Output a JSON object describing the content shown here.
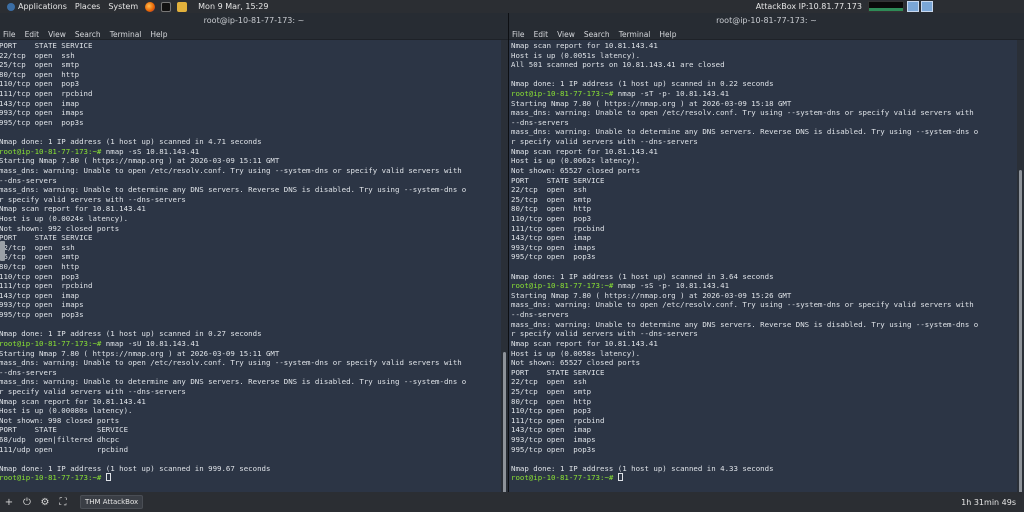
{
  "topbar": {
    "applications": "Applications",
    "places": "Places",
    "system": "System",
    "datetime": "Mon 9 Mar, 15:29",
    "attackbox_ip": "AttackBox IP:10.81.77.173"
  },
  "left_window": {
    "title": "root@ip-10-81-77-173: ~",
    "menu": [
      "File",
      "Edit",
      "View",
      "Search",
      "Terminal",
      "Help"
    ],
    "prompt": "root@ip-10-81-77-173:~#",
    "lines": [
      {
        "t": "PORT    STATE SERVICE"
      },
      {
        "t": "22/tcp  open  ssh"
      },
      {
        "t": "25/tcp  open  smtp"
      },
      {
        "t": "80/tcp  open  http"
      },
      {
        "t": "110/tcp open  pop3"
      },
      {
        "t": "111/tcp open  rpcbind"
      },
      {
        "t": "143/tcp open  imap"
      },
      {
        "t": "993/tcp open  imaps"
      },
      {
        "t": "995/tcp open  pop3s"
      },
      {
        "t": ""
      },
      {
        "t": "Nmap done: 1 IP address (1 host up) scanned in 4.71 seconds"
      },
      {
        "p": true,
        "t": " nmap -sS 10.81.143.41"
      },
      {
        "t": "Starting Nmap 7.80 ( https://nmap.org ) at 2026-03-09 15:11 GMT"
      },
      {
        "t": "mass_dns: warning: Unable to open /etc/resolv.conf. Try using --system-dns or specify valid servers with"
      },
      {
        "t": "--dns-servers"
      },
      {
        "t": "mass_dns: warning: Unable to determine any DNS servers. Reverse DNS is disabled. Try using --system-dns o"
      },
      {
        "t": "r specify valid servers with --dns-servers"
      },
      {
        "t": "Nmap scan report for 10.81.143.41"
      },
      {
        "t": "Host is up (0.0024s latency)."
      },
      {
        "t": "Not shown: 992 closed ports"
      },
      {
        "t": "PORT    STATE SERVICE"
      },
      {
        "t": "22/tcp  open  ssh"
      },
      {
        "t": "25/tcp  open  smtp"
      },
      {
        "t": "80/tcp  open  http"
      },
      {
        "t": "110/tcp open  pop3"
      },
      {
        "t": "111/tcp open  rpcbind"
      },
      {
        "t": "143/tcp open  imap"
      },
      {
        "t": "993/tcp open  imaps"
      },
      {
        "t": "995/tcp open  pop3s"
      },
      {
        "t": ""
      },
      {
        "t": "Nmap done: 1 IP address (1 host up) scanned in 0.27 seconds"
      },
      {
        "p": true,
        "t": " nmap -sU 10.81.143.41"
      },
      {
        "t": "Starting Nmap 7.80 ( https://nmap.org ) at 2026-03-09 15:11 GMT"
      },
      {
        "t": "mass_dns: warning: Unable to open /etc/resolv.conf. Try using --system-dns or specify valid servers with"
      },
      {
        "t": "--dns-servers"
      },
      {
        "t": "mass_dns: warning: Unable to determine any DNS servers. Reverse DNS is disabled. Try using --system-dns o"
      },
      {
        "t": "r specify valid servers with --dns-servers"
      },
      {
        "t": "Nmap scan report for 10.81.143.41"
      },
      {
        "t": "Host is up (0.00080s latency)."
      },
      {
        "t": "Not shown: 998 closed ports"
      },
      {
        "t": "PORT    STATE         SERVICE"
      },
      {
        "t": "68/udp  open|filtered dhcpc"
      },
      {
        "t": "111/udp open          rpcbind"
      },
      {
        "t": ""
      },
      {
        "t": "Nmap done: 1 IP address (1 host up) scanned in 999.67 seconds"
      },
      {
        "p": true,
        "t": " ",
        "cursor": true
      }
    ]
  },
  "right_window": {
    "title": "root@ip-10-81-77-173: ~",
    "menu": [
      "File",
      "Edit",
      "View",
      "Search",
      "Terminal",
      "Help"
    ],
    "prompt": "root@ip-10-81-77-173:~#",
    "lines": [
      {
        "t": "Nmap scan report for 10.81.143.41"
      },
      {
        "t": "Host is up (0.0051s latency)."
      },
      {
        "t": "All 501 scanned ports on 10.81.143.41 are closed"
      },
      {
        "t": ""
      },
      {
        "t": "Nmap done: 1 IP address (1 host up) scanned in 0.22 seconds"
      },
      {
        "p": true,
        "t": " nmap -sT -p- 10.81.143.41"
      },
      {
        "t": "Starting Nmap 7.80 ( https://nmap.org ) at 2026-03-09 15:18 GMT"
      },
      {
        "t": "mass_dns: warning: Unable to open /etc/resolv.conf. Try using --system-dns or specify valid servers with"
      },
      {
        "t": "--dns-servers"
      },
      {
        "t": "mass_dns: warning: Unable to determine any DNS servers. Reverse DNS is disabled. Try using --system-dns o"
      },
      {
        "t": "r specify valid servers with --dns-servers"
      },
      {
        "t": "Nmap scan report for 10.81.143.41"
      },
      {
        "t": "Host is up (0.0062s latency)."
      },
      {
        "t": "Not shown: 65527 closed ports"
      },
      {
        "t": "PORT    STATE SERVICE"
      },
      {
        "t": "22/tcp  open  ssh"
      },
      {
        "t": "25/tcp  open  smtp"
      },
      {
        "t": "80/tcp  open  http"
      },
      {
        "t": "110/tcp open  pop3"
      },
      {
        "t": "111/tcp open  rpcbind"
      },
      {
        "t": "143/tcp open  imap"
      },
      {
        "t": "993/tcp open  imaps"
      },
      {
        "t": "995/tcp open  pop3s"
      },
      {
        "t": ""
      },
      {
        "t": "Nmap done: 1 IP address (1 host up) scanned in 3.64 seconds"
      },
      {
        "p": true,
        "t": " nmap -sS -p- 10.81.143.41"
      },
      {
        "t": "Starting Nmap 7.80 ( https://nmap.org ) at 2026-03-09 15:26 GMT"
      },
      {
        "t": "mass_dns: warning: Unable to open /etc/resolv.conf. Try using --system-dns or specify valid servers with"
      },
      {
        "t": "--dns-servers"
      },
      {
        "t": "mass_dns: warning: Unable to determine any DNS servers. Reverse DNS is disabled. Try using --system-dns o"
      },
      {
        "t": "r specify valid servers with --dns-servers"
      },
      {
        "t": "Nmap scan report for 10.81.143.41"
      },
      {
        "t": "Host is up (0.0058s latency)."
      },
      {
        "t": "Not shown: 65527 closed ports"
      },
      {
        "t": "PORT    STATE SERVICE"
      },
      {
        "t": "22/tcp  open  ssh"
      },
      {
        "t": "25/tcp  open  smtp"
      },
      {
        "t": "80/tcp  open  http"
      },
      {
        "t": "110/tcp open  pop3"
      },
      {
        "t": "111/tcp open  rpcbind"
      },
      {
        "t": "143/tcp open  imap"
      },
      {
        "t": "993/tcp open  imaps"
      },
      {
        "t": "995/tcp open  pop3s"
      },
      {
        "t": ""
      },
      {
        "t": "Nmap done: 1 IP address (1 host up) scanned in 4.33 seconds"
      },
      {
        "p": true,
        "t": " ",
        "cursor": true
      }
    ]
  },
  "bottombar": {
    "task_label": "THM AttackBox",
    "timer": "1h 31min 49s"
  },
  "colors": {
    "terminal_bg": "#2c3545",
    "prompt": "#8ae234",
    "text": "#dfe3e8",
    "panel": "#2b2e33"
  },
  "icons": [
    "firefox-icon",
    "terminal-icon",
    "text-editor-icon",
    "add-icon",
    "power-icon",
    "settings-icon"
  ]
}
